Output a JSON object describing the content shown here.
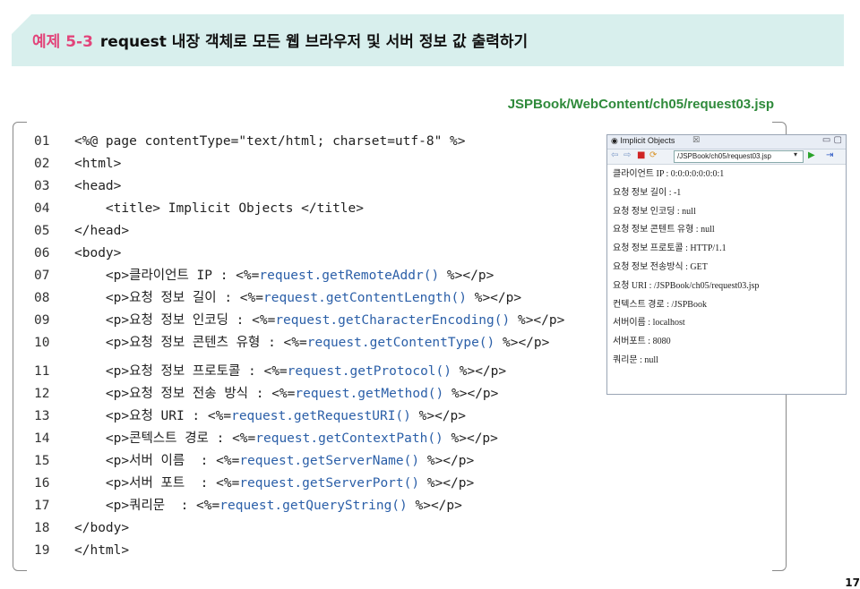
{
  "header": {
    "example_number": "예제 5-3",
    "title": "request 내장 객체로 모든 웹 브라우저 및 서버 정보 값 출력하기"
  },
  "file_path": "JSPBook/WebContent/ch05/request03.jsp",
  "code_lines": [
    {
      "num": "01",
      "pre": "<%@ page contentType=\"text/html; charset=utf-8\" %>",
      "expr": "",
      "post": ""
    },
    {
      "num": "02",
      "pre": "<html>",
      "expr": "",
      "post": ""
    },
    {
      "num": "03",
      "pre": "<head>",
      "expr": "",
      "post": ""
    },
    {
      "num": "04",
      "pre": "    <title> Implicit Objects </title>",
      "expr": "",
      "post": ""
    },
    {
      "num": "05",
      "pre": "</head>",
      "expr": "",
      "post": ""
    },
    {
      "num": "06",
      "pre": "<body>",
      "expr": "",
      "post": ""
    },
    {
      "num": "07",
      "pre": "    <p>클라이언트 IP : <%=",
      "expr": "request.getRemoteAddr()",
      "post": " %></p>"
    },
    {
      "num": "08",
      "pre": "    <p>요청 정보 길이 : <%=",
      "expr": "request.getContentLength()",
      "post": " %></p>"
    },
    {
      "num": "09",
      "pre": "    <p>요청 정보 인코딩 : <%=",
      "expr": "request.getCharacterEncoding()",
      "post": " %></p>"
    },
    {
      "num": "10",
      "pre": "    <p>요청 정보 콘텐츠 유형 : <%=",
      "expr": "request.getContentType()",
      "post": " %></p>"
    },
    {
      "num": "11",
      "pre": "    <p>요청 정보 프로토콜 : <%=",
      "expr": "request.getProtocol()",
      "post": " %></p>"
    },
    {
      "num": "12",
      "pre": "    <p>요청 정보 전송 방식 : <%=",
      "expr": "request.getMethod()",
      "post": " %></p>"
    },
    {
      "num": "13",
      "pre": "    <p>요청 URI : <%=",
      "expr": "request.getRequestURI()",
      "post": " %></p>"
    },
    {
      "num": "14",
      "pre": "    <p>콘텍스트 경로 : <%=",
      "expr": "request.getContextPath()",
      "post": " %></p>"
    },
    {
      "num": "15",
      "pre": "    <p>서버 이름  : <%=",
      "expr": "request.getServerName()",
      "post": " %></p>"
    },
    {
      "num": "16",
      "pre": "    <p>서버 포트  : <%=",
      "expr": "request.getServerPort()",
      "post": " %></p>"
    },
    {
      "num": "17",
      "pre": "    <p>쿼리문  : <%=",
      "expr": "request.getQueryString()",
      "post": " %></p>"
    },
    {
      "num": "18",
      "pre": "</body>",
      "expr": "",
      "post": ""
    },
    {
      "num": "19",
      "pre": "</html>",
      "expr": "",
      "post": ""
    }
  ],
  "browser": {
    "tab_label": "Implicit Objects",
    "tab_close": "☒",
    "window_controls": "▭ ▢",
    "url": "/JSPBook/ch05/request03.jsp",
    "lines": [
      "클라이언트 IP : 0:0:0:0:0:0:0:1",
      "요청 정보 길이 : -1",
      "요청 정보 인코딩 : null",
      "요청 정보 콘텐트 유형 : null",
      "요청 정보 프로토콜 : HTTP/1.1",
      "요청 정보 전송방식 : GET",
      "요청 URI : /JSPBook/ch05/request03.jsp",
      "컨텍스트 경로 : /JSPBook",
      "서버이름 : localhost",
      "서버포트 : 8080",
      "쿼리문 : null"
    ]
  },
  "page_number": "17"
}
